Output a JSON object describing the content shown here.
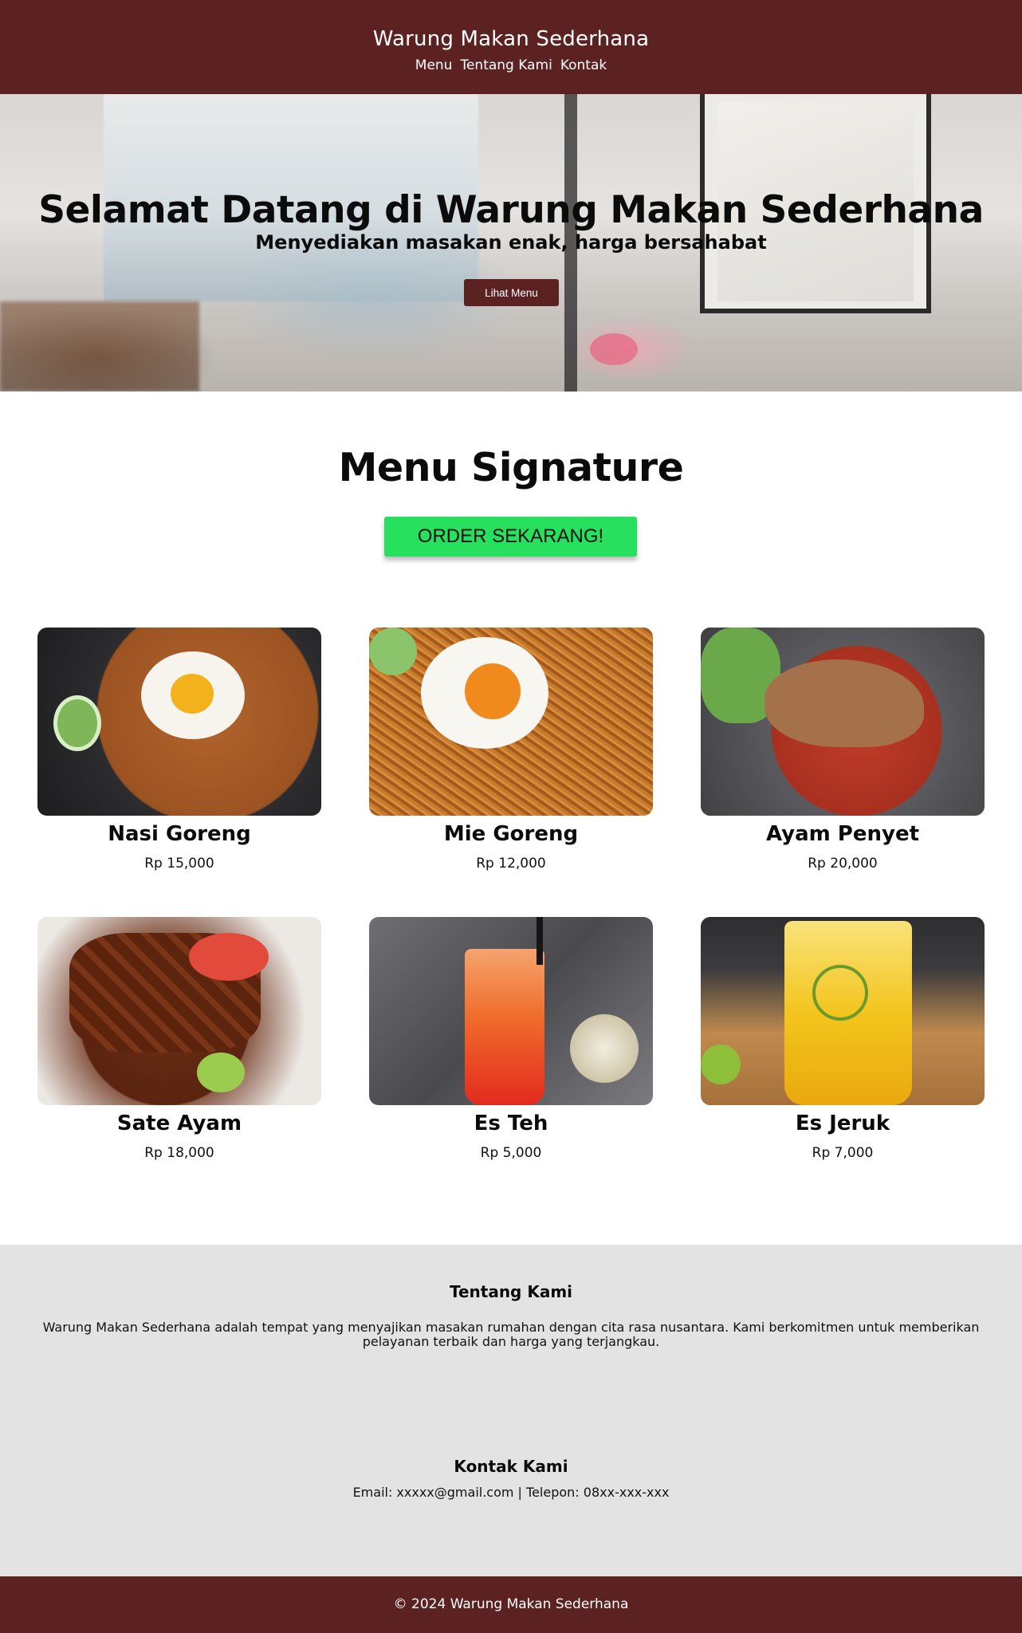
{
  "header": {
    "title": "Warung Makan Sederhana",
    "nav": [
      "Menu",
      "Tentang Kami",
      "Kontak"
    ]
  },
  "hero": {
    "title": "Selamat Datang di Warung Makan Sederhana",
    "subtitle": "Menyediakan masakan enak, harga bersahabat",
    "button": "Lihat Menu"
  },
  "menu": {
    "title": "Menu Signature",
    "order_button": "ORDER SEKARANG!",
    "items": [
      {
        "name": "Nasi Goreng",
        "price": "Rp 15,000",
        "icon": "fried-rice-photo"
      },
      {
        "name": "Mie Goreng",
        "price": "Rp 12,000",
        "icon": "fried-noodles-photo"
      },
      {
        "name": "Ayam Penyet",
        "price": "Rp 20,000",
        "icon": "smashed-chicken-photo"
      },
      {
        "name": "Sate Ayam",
        "price": "Rp 18,000",
        "icon": "chicken-satay-photo"
      },
      {
        "name": "Es Teh",
        "price": "Rp 5,000",
        "icon": "iced-tea-photo"
      },
      {
        "name": "Es Jeruk",
        "price": "Rp 7,000",
        "icon": "iced-orange-photo"
      }
    ]
  },
  "about": {
    "title": "Tentang Kami",
    "text": "Warung Makan Sederhana adalah tempat yang menyajikan masakan rumahan dengan cita rasa nusantara. Kami berkomitmen untuk memberikan pelayanan terbaik dan harga yang terjangkau."
  },
  "contact": {
    "title": "Kontak Kami",
    "text": "Email: xxxxx@gmail.com | Telepon: 08xx-xxx-xxx"
  },
  "footer": {
    "copyright": "© 2024 Warung Makan Sederhana"
  },
  "colors": {
    "brand": "#5c2222",
    "order_button": "#27e05e",
    "info_background": "#e3e3e3"
  }
}
